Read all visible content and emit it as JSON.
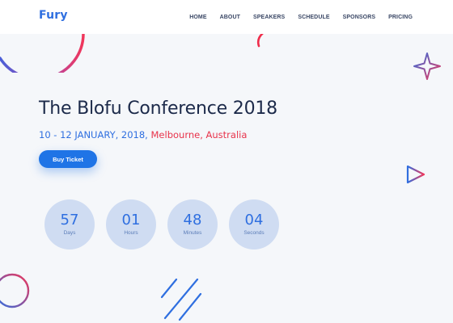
{
  "navbar": {
    "logo": "Fury",
    "links": [
      "HOME",
      "ABOUT",
      "SPEAKERS",
      "SCHEDULE",
      "SPONSORS",
      "PRICING"
    ]
  },
  "hero": {
    "title": "The Blofu Conference 2018",
    "date": "10 - 12 JANUARY, 2018, ",
    "location": "Melbourne, Australia",
    "button_label": "Buy Ticket"
  },
  "countdown": [
    {
      "value": "57",
      "label": "Days"
    },
    {
      "value": "01",
      "label": "Hours"
    },
    {
      "value": "48",
      "label": "Minutes"
    },
    {
      "value": "04",
      "label": "Seconds"
    }
  ],
  "colors": {
    "accent": "#2f6fe0",
    "highlight": "#e8334b",
    "button": "#1f74e6",
    "countdown_circle": "#cfdcf2",
    "background": "#f5f7fa"
  },
  "decorations": [
    "gradient-arc",
    "red-arc",
    "sparkle-star",
    "play-triangle",
    "circle-outline",
    "diagonal-lines"
  ]
}
